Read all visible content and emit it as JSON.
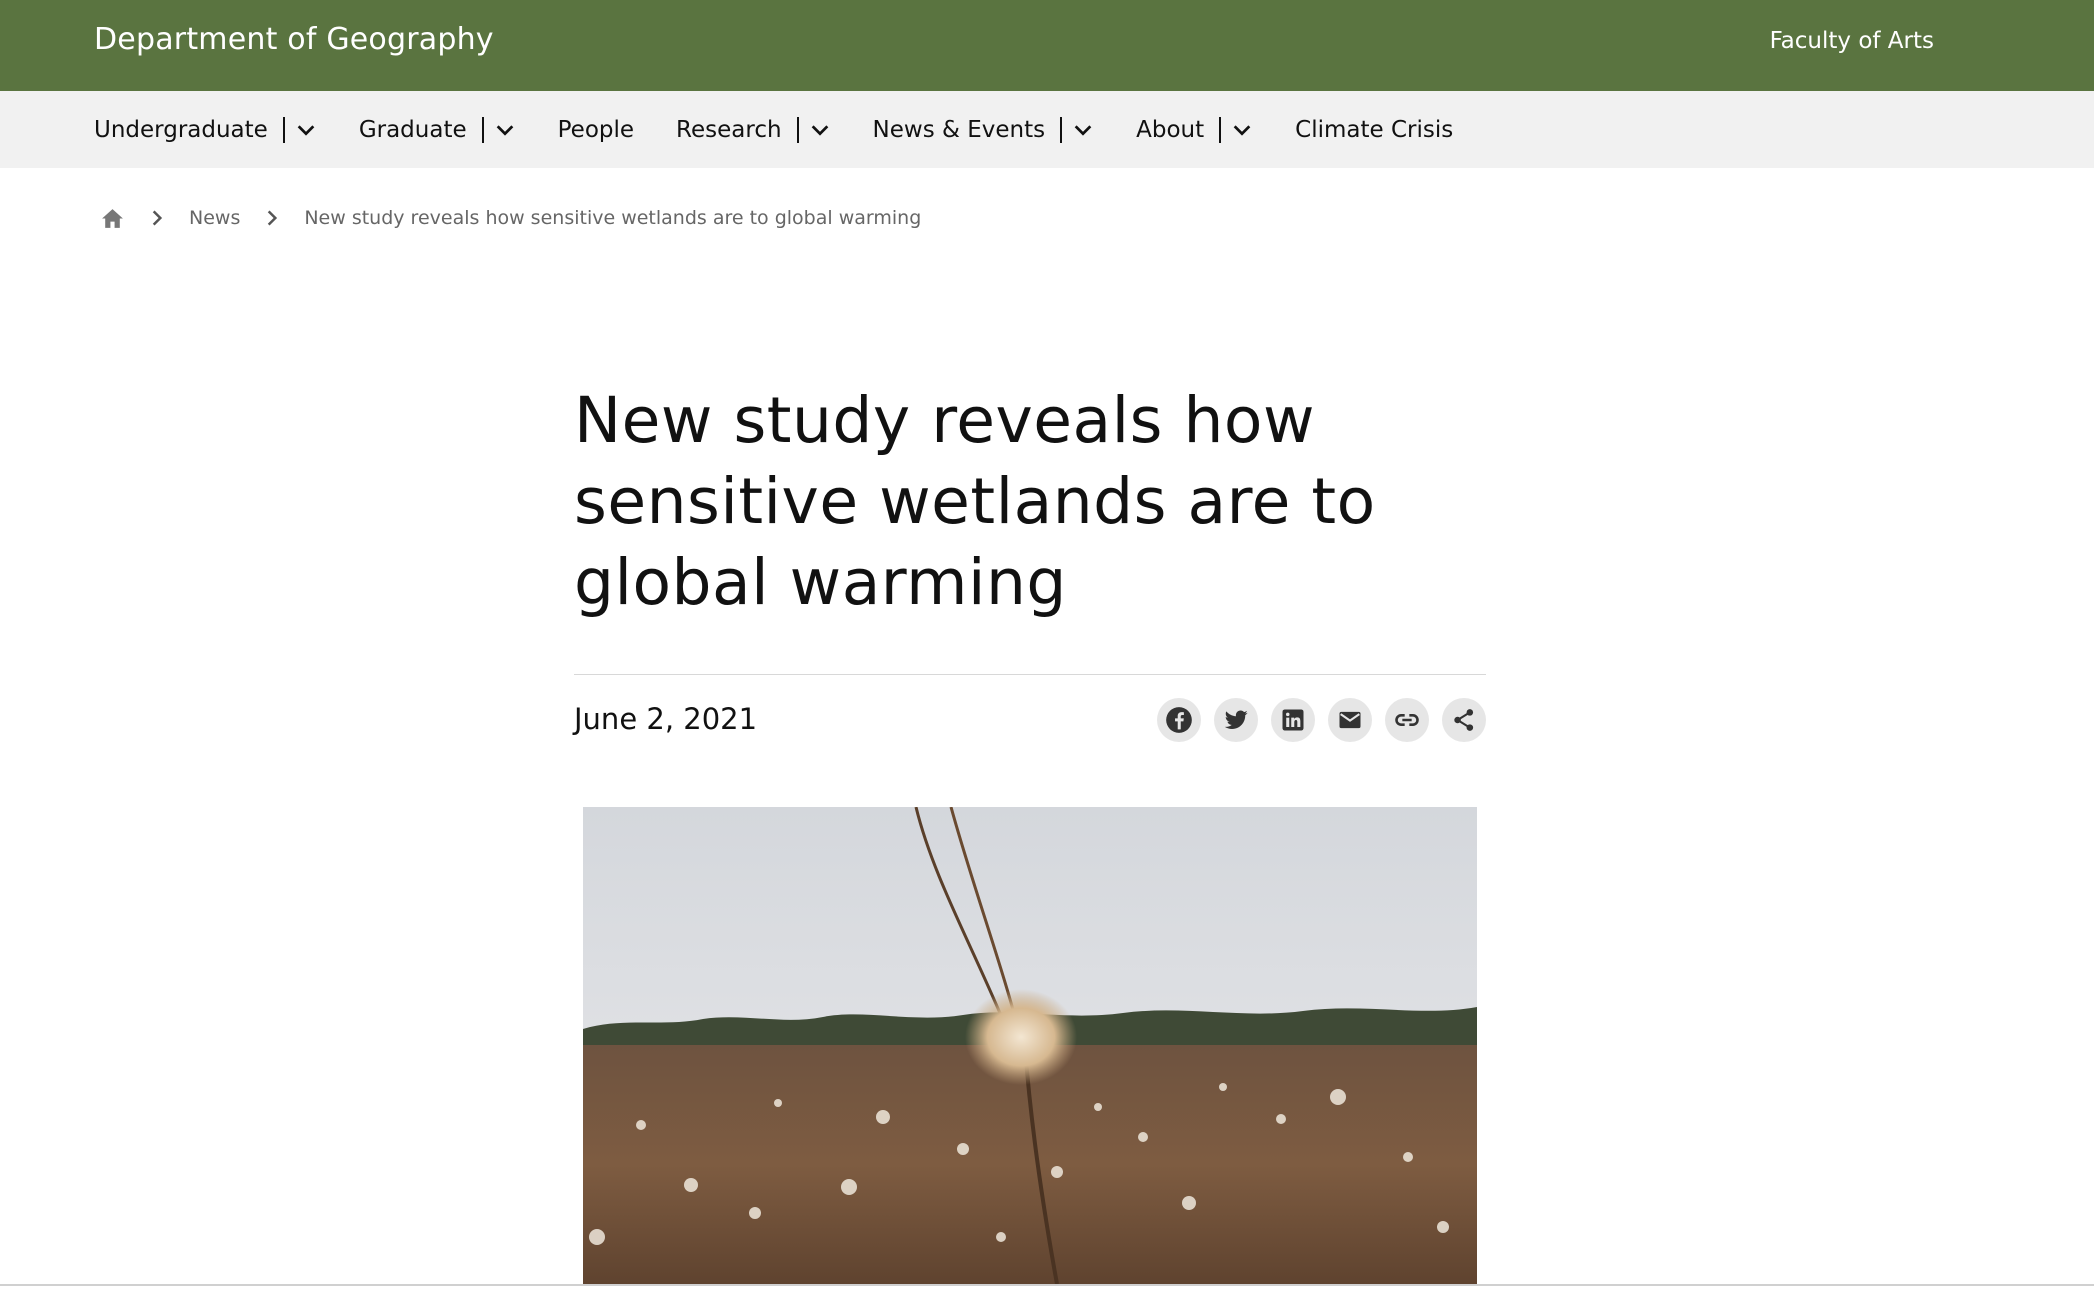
{
  "header": {
    "department": "Department of Geography",
    "faculty": "Faculty of Arts",
    "brand_color": "#5a7440"
  },
  "nav": {
    "items": [
      {
        "label": "Undergraduate",
        "has_dropdown": true
      },
      {
        "label": "Graduate",
        "has_dropdown": true
      },
      {
        "label": "People",
        "has_dropdown": false
      },
      {
        "label": "Research",
        "has_dropdown": true
      },
      {
        "label": "News & Events",
        "has_dropdown": true
      },
      {
        "label": "About",
        "has_dropdown": true
      },
      {
        "label": "Climate Crisis",
        "has_dropdown": false
      }
    ]
  },
  "breadcrumb": {
    "home_icon": "home-icon",
    "items": [
      "News",
      "New study reveals how sensitive wetlands are to global warming"
    ]
  },
  "article": {
    "title": "New study reveals how sensitive wetlands are to global warming",
    "date": "June 2, 2021",
    "share": [
      "facebook-icon",
      "twitter-icon",
      "linkedin-icon",
      "email-icon",
      "link-icon",
      "share-icon"
    ]
  }
}
